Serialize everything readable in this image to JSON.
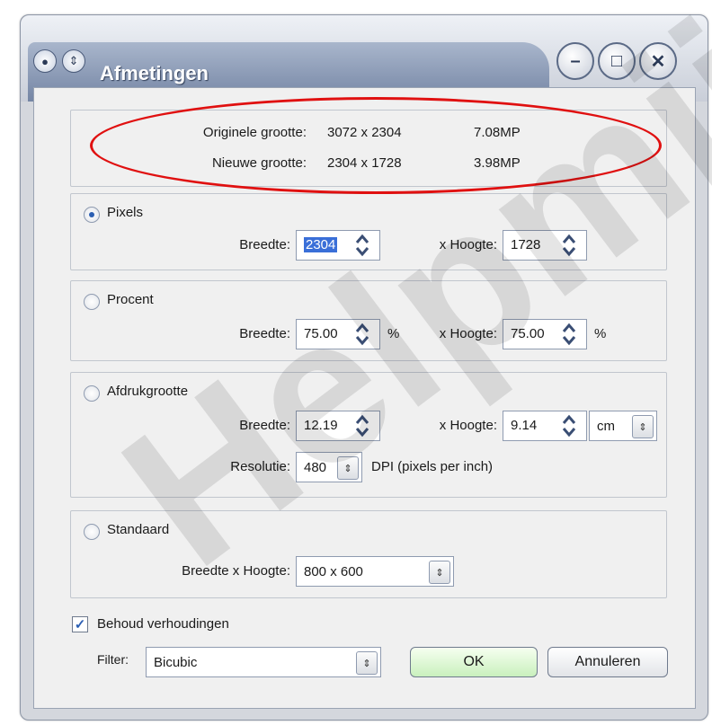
{
  "window": {
    "title": "Afmetingen"
  },
  "summary": {
    "original_label": "Originele grootte:",
    "original_size": "3072 x 2304",
    "original_mp": "7.08MP",
    "new_label": "Nieuwe grootte:",
    "new_size": "2304 x 1728",
    "new_mp": "3.98MP"
  },
  "pixels": {
    "radio_label": "Pixels",
    "width_label": "Breedte:",
    "width_value": "2304",
    "height_label": "x Hoogte:",
    "height_value": "1728"
  },
  "percent": {
    "radio_label": "Procent",
    "width_label": "Breedte:",
    "width_value": "75.00",
    "unit": "%",
    "height_label": "x Hoogte:",
    "height_value": "75.00",
    "unit2": "%"
  },
  "print": {
    "radio_label": "Afdrukgrootte",
    "width_label": "Breedte:",
    "width_value": "12.19",
    "height_label": "x Hoogte:",
    "height_value": "9.14",
    "unit_value": "cm",
    "resolution_label": "Resolutie:",
    "resolution_value": "480",
    "resolution_unit": "DPI (pixels per inch)"
  },
  "standard": {
    "radio_label": "Standaard",
    "size_label": "Breedte x Hoogte:",
    "size_value": "800 x 600"
  },
  "keep_ratio": {
    "label": "Behoud verhoudingen",
    "checked": true
  },
  "filter": {
    "label": "Filter:",
    "value": "Bicubic"
  },
  "buttons": {
    "ok": "OK",
    "cancel": "Annuleren"
  },
  "watermark": "Helpmij",
  "colors": {
    "annotation": "#e01010",
    "ok_button": "#c9f0bd"
  }
}
